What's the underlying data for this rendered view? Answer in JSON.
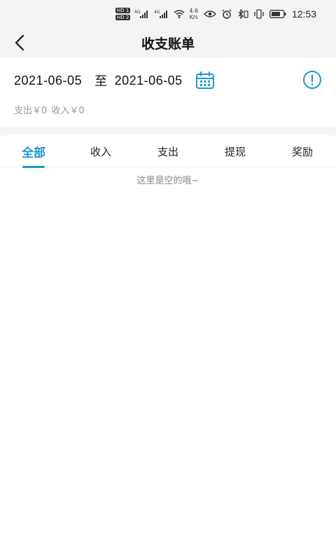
{
  "status_bar": {
    "hd1": "HD 1",
    "hd2": "HD 2",
    "signal1": "4G",
    "signal2": "4G",
    "net_speed_value": "4.6",
    "net_speed_unit": "K/s",
    "time": "12:53",
    "icons": [
      "hd-badge",
      "signal-icon",
      "signal-icon",
      "wifi-icon",
      "eye-icon",
      "alarm-icon",
      "bluetooth-icon",
      "vibrate-icon",
      "battery-icon"
    ]
  },
  "header": {
    "title": "收支账单",
    "back_icon": "chevron-left-icon"
  },
  "date_range": {
    "start": "2021-06-05",
    "to_word": "至",
    "end": "2021-06-05",
    "calendar_icon": "calendar-icon",
    "info_icon": "info-icon"
  },
  "summary": {
    "expense_label": "支出￥0",
    "income_label": "收入￥0"
  },
  "tabs": [
    {
      "label": "全部",
      "active": true
    },
    {
      "label": "收入",
      "active": false
    },
    {
      "label": "支出",
      "active": false
    },
    {
      "label": "提现",
      "active": false
    },
    {
      "label": "奖励",
      "active": false
    }
  ],
  "empty_state": {
    "text": "这里是空的哦~"
  },
  "colors": {
    "accent": "#1a98d5",
    "background_gray": "#f4f4f4",
    "muted_text": "#999999"
  }
}
